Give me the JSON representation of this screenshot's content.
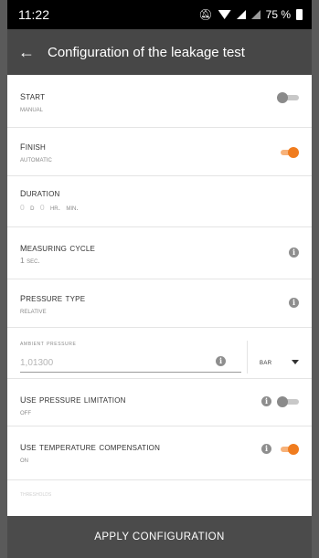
{
  "status_bar": {
    "time": "11:22",
    "battery": "75 %",
    "icons": [
      "mute-icon",
      "wifi-icon",
      "signal-icon",
      "battery-icon"
    ]
  },
  "app_bar": {
    "title": "Configuration of the leakage test",
    "back_icon": "arrow-left-icon"
  },
  "settings": {
    "start": {
      "title": "Start",
      "value": "Manual",
      "toggle": "off"
    },
    "finish": {
      "title": "Finish",
      "value": "Automatic",
      "toggle": "on"
    },
    "duration": {
      "title": "Duration",
      "d_value": "0",
      "d_unit": "D",
      "h_value": "0",
      "h_unit": "Hr.",
      "min_unit": "Min."
    },
    "measuring_cycle": {
      "title": "Measuring cycle",
      "value": "1 Sec."
    },
    "pressure_type": {
      "title": "Pressure type",
      "value": "Relative"
    },
    "ambient_pressure": {
      "label": "Ambient pressure",
      "value": "1,01300",
      "unit": "bar"
    },
    "pressure_limitation": {
      "title": "Use pressure limitation",
      "value": "Off",
      "toggle": "off"
    },
    "temperature_compensation": {
      "title": "Use temperature compensation",
      "value": "On",
      "toggle": "on"
    },
    "faded_label": "Thresholds"
  },
  "apply_button": {
    "label": "APPLY CONFIGURATION"
  },
  "colors": {
    "accent": "#f07c1e",
    "app_bar": "#474747",
    "status_bar": "#000000"
  }
}
